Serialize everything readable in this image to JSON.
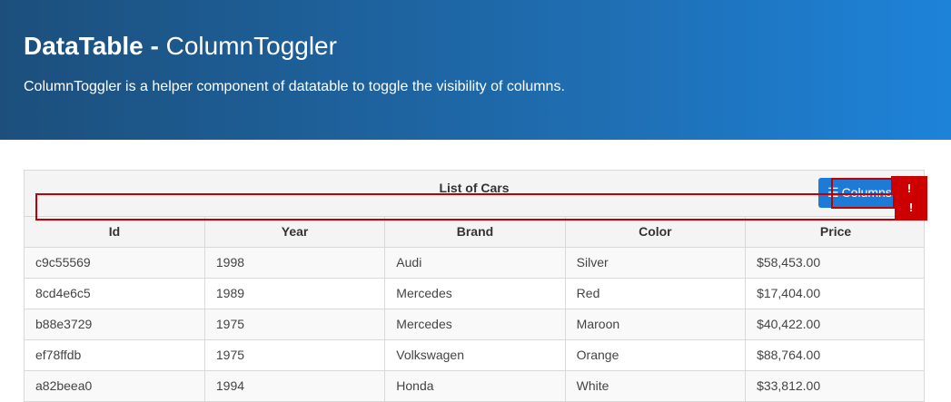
{
  "hero": {
    "title_bold": "DataTable -",
    "title_rest": "ColumnToggler",
    "subtitle": "ColumnToggler is a helper component of datatable to toggle the visibility of columns."
  },
  "table": {
    "caption": "List of Cars",
    "toggler_label": "Columns",
    "toggler_icon": "list-icon",
    "columns": [
      "Id",
      "Year",
      "Brand",
      "Color",
      "Price"
    ],
    "rows": [
      [
        "c9c55569",
        "1998",
        "Audi",
        "Silver",
        "$58,453.00"
      ],
      [
        "8cd4e6c5",
        "1989",
        "Mercedes",
        "Red",
        "$17,404.00"
      ],
      [
        "b88e3729",
        "1975",
        "Mercedes",
        "Maroon",
        "$40,422.00"
      ],
      [
        "ef78ffdb",
        "1975",
        "Volkswagen",
        "Orange",
        "$88,764.00"
      ],
      [
        "a82beea0",
        "1994",
        "Honda",
        "White",
        "$33,812.00"
      ]
    ]
  },
  "error_markers": {
    "badge_text": "!"
  },
  "colors": {
    "hero_gradient_start": "#1c4f7c",
    "hero_gradient_end": "#1d83d9",
    "button": "#1d7bd7",
    "error": "#c00000"
  }
}
